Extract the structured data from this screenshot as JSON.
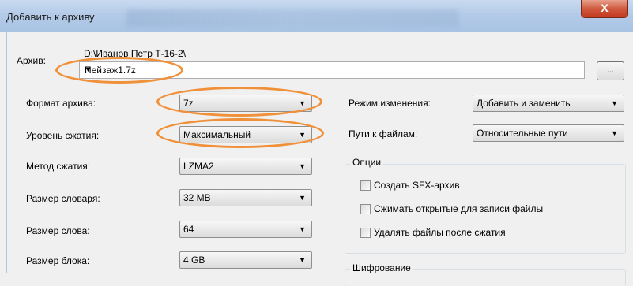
{
  "window": {
    "title": "Добавить к архиву",
    "close_glyph": "X"
  },
  "archive": {
    "label": "Архив:",
    "path": "D:\\Иванов Петр Т-16-2\\",
    "value": "Пейзаж1.7z",
    "browse_label": "..."
  },
  "left": {
    "format": {
      "label": "Формат архива:",
      "value": "7z"
    },
    "level": {
      "label": "Уровень сжатия:",
      "value": "Максимальный"
    },
    "method": {
      "label": "Метод сжатия:",
      "value": "LZMA2"
    },
    "dict": {
      "label": "Размер словаря:",
      "value": "32 MB"
    },
    "word": {
      "label": "Размер слова:",
      "value": "64"
    },
    "block": {
      "label": "Размер блока:",
      "value": "4 GB"
    }
  },
  "right": {
    "update": {
      "label": "Режим изменения:",
      "value": "Добавить и заменить"
    },
    "paths": {
      "label": "Пути к файлам:",
      "value": "Относительные пути"
    }
  },
  "options": {
    "title": "Опции",
    "sfx": "Создать SFX-архив",
    "shared": "Сжимать открытые для записи файлы",
    "delete": "Удалять файлы после сжатия"
  },
  "encryption": {
    "title": "Шифрование"
  },
  "icons": {
    "dropdown": "chevron-down-icon",
    "close": "close-icon"
  },
  "colors": {
    "highlight": "#f0913a",
    "close": "#c2391f"
  }
}
